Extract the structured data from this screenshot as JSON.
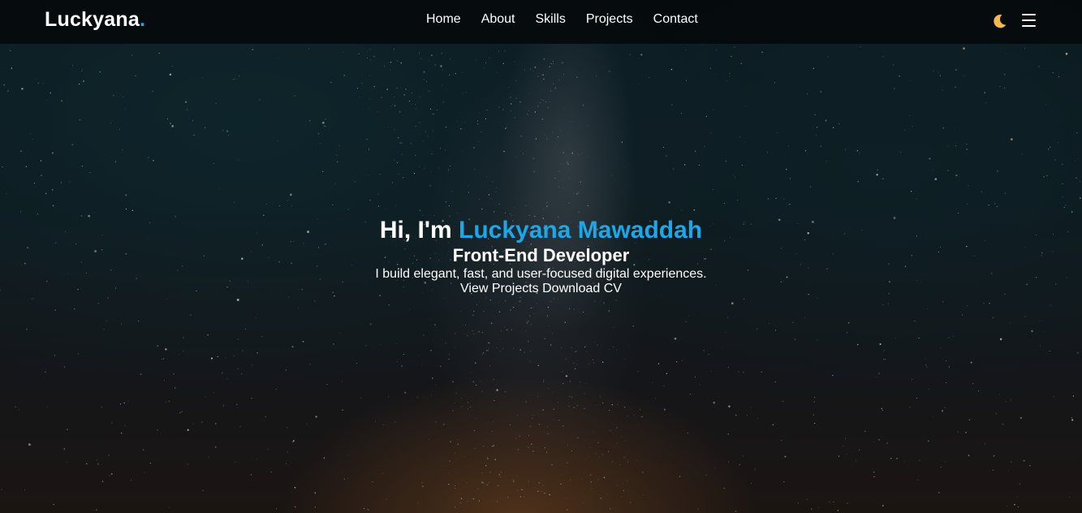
{
  "navbar": {
    "logo_text": "Luckyana",
    "logo_dot": ".",
    "links": [
      "Home",
      "About",
      "Skills",
      "Projects",
      "Contact"
    ],
    "theme_icon": "moon-icon",
    "menu_icon": "hamburger-menu-icon"
  },
  "hero": {
    "greeting": "Hi, I'm",
    "name": "Luckyana Mawaddah",
    "role": "Front-End Developer",
    "description": "I build elegant, fast, and user-focused digital experiences.",
    "buttons": {
      "view_projects": "View Projects",
      "download_cv": "Download CV"
    }
  },
  "colors": {
    "accent": "#1ba7e8",
    "moon": "#f5b94a",
    "navbar_bg": "#050a0c"
  }
}
